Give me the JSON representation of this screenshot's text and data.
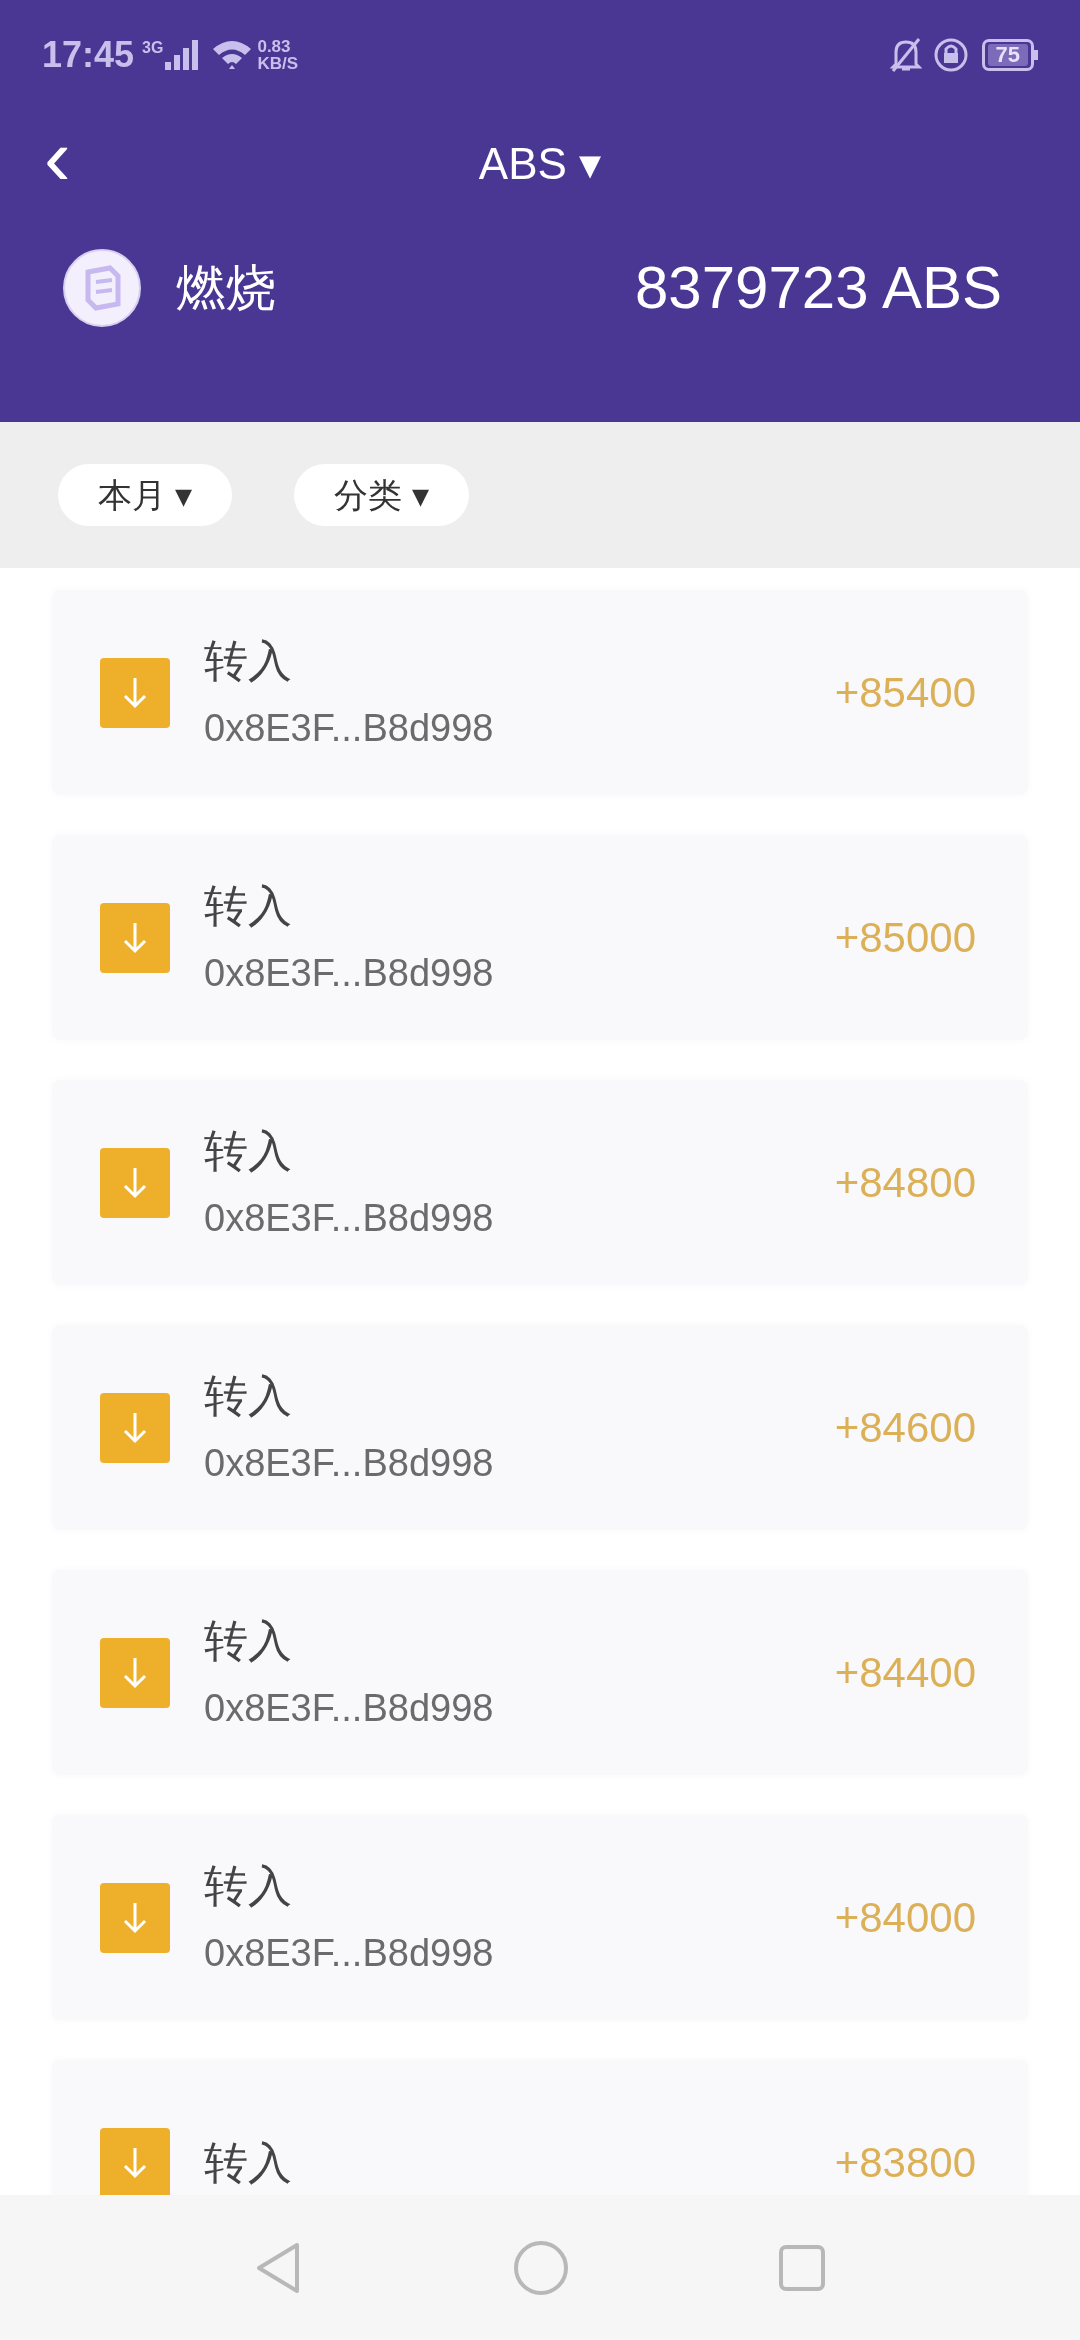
{
  "status_bar": {
    "time": "17:45",
    "network": "3G",
    "speed_value": "0.83",
    "speed_unit": "KB/S",
    "battery": "75"
  },
  "header": {
    "title": "ABS ▾",
    "back": "‹"
  },
  "summary": {
    "name": "燃烧",
    "balance": "8379723 ABS"
  },
  "filters": [
    {
      "label": "本月 ▾"
    },
    {
      "label": "分类 ▾"
    }
  ],
  "transactions": [
    {
      "type": "转入",
      "address": "0x8E3F...B8d998",
      "amount": "+85400"
    },
    {
      "type": "转入",
      "address": "0x8E3F...B8d998",
      "amount": "+85000"
    },
    {
      "type": "转入",
      "address": "0x8E3F...B8d998",
      "amount": "+84800"
    },
    {
      "type": "转入",
      "address": "0x8E3F...B8d998",
      "amount": "+84600"
    },
    {
      "type": "转入",
      "address": "0x8E3F...B8d998",
      "amount": "+84400"
    },
    {
      "type": "转入",
      "address": "0x8E3F...B8d998",
      "amount": "+84000"
    },
    {
      "type": "转入",
      "amount": "+83800"
    }
  ]
}
